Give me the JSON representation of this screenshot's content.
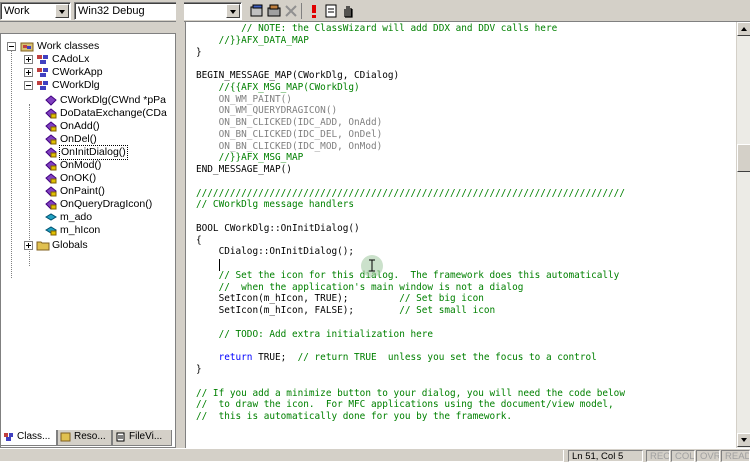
{
  "toolbar": {
    "workspace_combo": "Work",
    "config_combo": "Win32 Debug"
  },
  "tree": {
    "root": "Work classes",
    "items": [
      {
        "label": "CAdoLx",
        "kind": "class"
      },
      {
        "label": "CWorkApp",
        "kind": "class"
      },
      {
        "label": "CWorkDlg",
        "kind": "class"
      },
      {
        "label": "CWorkDlg(CWnd *pPa",
        "kind": "method"
      },
      {
        "label": "DoDataExchange(CDa",
        "kind": "method"
      },
      {
        "label": "OnAdd()",
        "kind": "method"
      },
      {
        "label": "OnDel()",
        "kind": "method"
      },
      {
        "label": "OnInitDialog()",
        "kind": "method",
        "selected": true
      },
      {
        "label": "OnMod()",
        "kind": "method"
      },
      {
        "label": "OnOK()",
        "kind": "method"
      },
      {
        "label": "OnPaint()",
        "kind": "method"
      },
      {
        "label": "OnQueryDragIcon()",
        "kind": "method"
      },
      {
        "label": "m_ado",
        "kind": "member"
      },
      {
        "label": "m_hIcon",
        "kind": "member"
      },
      {
        "label": "Globals",
        "kind": "folder"
      }
    ]
  },
  "tabs": [
    {
      "label": "Class...",
      "active": true
    },
    {
      "label": "Reso...",
      "active": false
    },
    {
      "label": "FileVi...",
      "active": false
    }
  ],
  "code": [
    {
      "text": "        // NOTE: the ClassWizard will add DDX and DDV calls here",
      "style": "green"
    },
    {
      "text": "    //}}AFX_DATA_MAP",
      "style": "green"
    },
    {
      "text": "}",
      "style": "normal"
    },
    {
      "text": "",
      "style": "normal"
    },
    {
      "text": "BEGIN_MESSAGE_MAP(CWorkDlg, CDialog)",
      "style": "normal"
    },
    {
      "text": "    //{{AFX_MSG_MAP(CWorkDlg)",
      "style": "green"
    },
    {
      "text": "    ON_WM_PAINT()",
      "style": "gray"
    },
    {
      "text": "    ON_WM_QUERYDRAGICON()",
      "style": "gray"
    },
    {
      "text": "    ON_BN_CLICKED(IDC_ADD, OnAdd)",
      "style": "gray"
    },
    {
      "text": "    ON_BN_CLICKED(IDC_DEL, OnDel)",
      "style": "gray"
    },
    {
      "text": "    ON_BN_CLICKED(IDC_MOD, OnMod)",
      "style": "gray"
    },
    {
      "text": "    //}}AFX_MSG_MAP",
      "style": "green"
    },
    {
      "text": "END_MESSAGE_MAP()",
      "style": "normal"
    },
    {
      "text": "",
      "style": "normal"
    },
    {
      "text": "////////////////////////////////////////////////////////////////////////////",
      "style": "green"
    },
    {
      "text": "// CWorkDlg message handlers",
      "style": "green"
    },
    {
      "text": "",
      "style": "normal"
    },
    {
      "text": "BOOL CWorkDlg::OnInitDialog()",
      "style": "normal"
    },
    {
      "text": "{",
      "style": "normal"
    },
    {
      "text": "    CDialog::OnInitDialog();",
      "style": "normal"
    },
    {
      "text": "",
      "style": "normal"
    },
    {
      "text": "    // Set the icon for this dialog.  The framework does this automatically",
      "style": "green"
    },
    {
      "text": "    //  when the application's main window is not a dialog",
      "style": "green"
    },
    {
      "text": "    SetIcon(m_hIcon, TRUE);         // Set big icon",
      "style": "mixed_big"
    },
    {
      "text": "    SetIcon(m_hIcon, FALSE);        // Set small icon",
      "style": "mixed_small"
    },
    {
      "text": "",
      "style": "normal"
    },
    {
      "text": "    // TODO: Add extra initialization here",
      "style": "green"
    },
    {
      "text": "",
      "style": "normal"
    },
    {
      "text": "    return TRUE;  // return TRUE  unless you set the focus to a control",
      "style": "mixed_return"
    },
    {
      "text": "}",
      "style": "normal"
    },
    {
      "text": "",
      "style": "normal"
    },
    {
      "text": "// If you add a minimize button to your dialog, you will need the code below",
      "style": "green"
    },
    {
      "text": "//  to draw the icon.  For MFC applications using the document/view model,",
      "style": "green"
    },
    {
      "text": "//  this is automatically done for you by the framework.",
      "style": "green"
    }
  ],
  "status": {
    "position": "Ln 51, Col 5",
    "rec": "REC",
    "col": "COL",
    "ovr": "OVR",
    "read": "READ"
  }
}
